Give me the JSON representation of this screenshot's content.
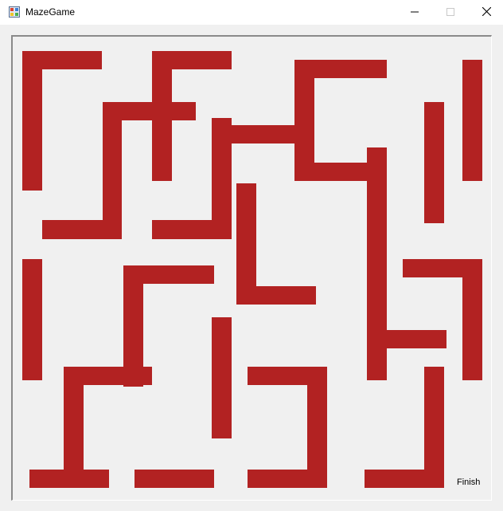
{
  "window": {
    "title": "MazeGame",
    "controls": {
      "minimize_icon": "minimize-icon",
      "maximize_icon": "maximize-icon",
      "close_icon": "close-icon"
    }
  },
  "maze": {
    "wall_color": "#b22222",
    "background_color": "#f0f0f0",
    "finish_label": "Finish"
  }
}
